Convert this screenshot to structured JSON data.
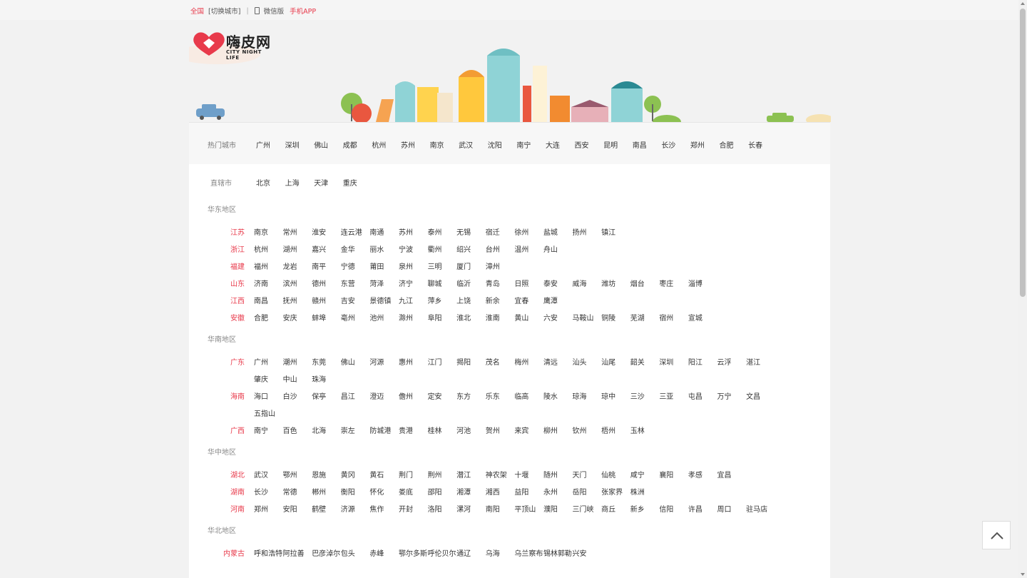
{
  "topbar": {
    "national": "全国",
    "switch_city": "[切换城市]",
    "wechat": "微信版",
    "app": "手机APP"
  },
  "logo": {
    "title": "嗨皮网",
    "subtitle": "CITY NIGHT LIFE"
  },
  "hot": {
    "label": "热门城市",
    "cities": [
      "广州",
      "深圳",
      "佛山",
      "成都",
      "杭州",
      "苏州",
      "南京",
      "武汉",
      "沈阳",
      "南宁",
      "大连",
      "西安",
      "昆明",
      "南昌",
      "长沙",
      "郑州",
      "合肥",
      "长春"
    ]
  },
  "direct": {
    "label": "直辖市",
    "cities": [
      "北京",
      "上海",
      "天津",
      "重庆"
    ]
  },
  "regions": [
    {
      "name": "华东地区",
      "provinces": [
        {
          "name": "江苏",
          "cities": [
            "南京",
            "常州",
            "淮安",
            "连云港",
            "南通",
            "苏州",
            "泰州",
            "无锡",
            "宿迁",
            "徐州",
            "盐城",
            "扬州",
            "镇江"
          ]
        },
        {
          "name": "浙江",
          "cities": [
            "杭州",
            "湖州",
            "嘉兴",
            "金华",
            "丽水",
            "宁波",
            "衢州",
            "绍兴",
            "台州",
            "温州",
            "舟山"
          ]
        },
        {
          "name": "福建",
          "cities": [
            "福州",
            "龙岩",
            "南平",
            "宁德",
            "莆田",
            "泉州",
            "三明",
            "厦门",
            "漳州"
          ]
        },
        {
          "name": "山东",
          "cities": [
            "济南",
            "滨州",
            "德州",
            "东营",
            "菏泽",
            "济宁",
            "聊城",
            "临沂",
            "青岛",
            "日照",
            "泰安",
            "威海",
            "潍坊",
            "烟台",
            "枣庄",
            "淄博"
          ]
        },
        {
          "name": "江西",
          "cities": [
            "南昌",
            "抚州",
            "赣州",
            "吉安",
            "景德镇",
            "九江",
            "萍乡",
            "上饶",
            "新余",
            "宜春",
            "鹰潭"
          ]
        },
        {
          "name": "安徽",
          "cities": [
            "合肥",
            "安庆",
            "蚌埠",
            "亳州",
            "池州",
            "滁州",
            "阜阳",
            "淮北",
            "淮南",
            "黄山",
            "六安",
            "马鞍山",
            "铜陵",
            "芜湖",
            "宿州",
            "宣城"
          ]
        }
      ]
    },
    {
      "name": "华南地区",
      "provinces": [
        {
          "name": "广东",
          "cities": [
            "广州",
            "潮州",
            "东莞",
            "佛山",
            "河源",
            "惠州",
            "江门",
            "揭阳",
            "茂名",
            "梅州",
            "清远",
            "汕头",
            "汕尾",
            "韶关",
            "深圳",
            "阳江",
            "云浮",
            "湛江",
            "肇庆",
            "中山",
            "珠海"
          ]
        },
        {
          "name": "海南",
          "cities": [
            "海口",
            "白沙",
            "保亭",
            "昌江",
            "澄迈",
            "儋州",
            "定安",
            "东方",
            "乐东",
            "临高",
            "陵水",
            "琼海",
            "琼中",
            "三沙",
            "三亚",
            "屯昌",
            "万宁",
            "文昌",
            "五指山"
          ]
        },
        {
          "name": "广西",
          "cities": [
            "南宁",
            "百色",
            "北海",
            "崇左",
            "防城港",
            "贵港",
            "桂林",
            "河池",
            "贺州",
            "来宾",
            "柳州",
            "钦州",
            "梧州",
            "玉林"
          ]
        }
      ]
    },
    {
      "name": "华中地区",
      "provinces": [
        {
          "name": "湖北",
          "cities": [
            "武汉",
            "鄂州",
            "恩施",
            "黄冈",
            "黄石",
            "荆门",
            "荆州",
            "潜江",
            "神农架",
            "十堰",
            "随州",
            "天门",
            "仙桃",
            "咸宁",
            "襄阳",
            "孝感",
            "宜昌"
          ]
        },
        {
          "name": "湖南",
          "cities": [
            "长沙",
            "常德",
            "郴州",
            "衡阳",
            "怀化",
            "娄底",
            "邵阳",
            "湘潭",
            "湘西",
            "益阳",
            "永州",
            "岳阳",
            "张家界",
            "株洲"
          ]
        },
        {
          "name": "河南",
          "cities": [
            "郑州",
            "安阳",
            "鹤壁",
            "济源",
            "焦作",
            "开封",
            "洛阳",
            "漯河",
            "南阳",
            "平顶山",
            "濮阳",
            "三门峡",
            "商丘",
            "新乡",
            "信阳",
            "许昌",
            "周口",
            "驻马店"
          ]
        }
      ]
    },
    {
      "name": "华北地区",
      "provinces": [
        {
          "name": "内蒙古",
          "cities": [
            "呼和浩特",
            "阿拉善",
            "巴彦淖尔",
            "包头",
            "赤峰",
            "鄂尔多斯",
            "呼伦贝尔",
            "通辽",
            "乌海",
            "乌兰察布",
            "锡林郭勒",
            "兴安"
          ]
        }
      ]
    }
  ],
  "colors": {
    "accent": "#e83a4b",
    "background": "#f2f2f2"
  }
}
